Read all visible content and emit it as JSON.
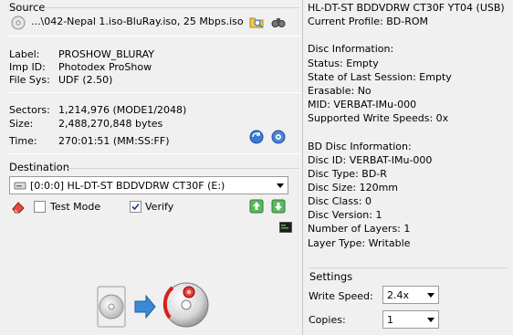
{
  "source": {
    "title": "Source",
    "file": "...\\042-Nepal 1.iso-BluRay.iso, 25 Mbps.iso",
    "label_key": "Label:",
    "label_value": "PROSHOW_BLURAY",
    "imp_key": "Imp ID:",
    "imp_value": "Photodex ProShow",
    "fs_key": "File Sys:",
    "fs_value": "UDF (2.50)",
    "sectors_key": "Sectors:",
    "sectors_value": "1,214,976 (MODE1/2048)",
    "size_key": "Size:",
    "size_value": "2,488,270,848 bytes",
    "time_key": "Time:",
    "time_value": "270:01:51 (MM:SS:FF)"
  },
  "destination": {
    "title": "Destination",
    "drive": "[0:0:0] HL-DT-ST BDDVDRW CT30F (E:)",
    "test_mode_label": "Test Mode",
    "test_mode_checked": false,
    "verify_label": "Verify",
    "verify_checked": true
  },
  "info": {
    "lines": [
      "HL-DT-ST BDDVDRW CT30F YT04 (USB)",
      "Current Profile: BD-ROM",
      "",
      "Disc Information:",
      "Status: Empty",
      "State of Last Session: Empty",
      "Erasable: No",
      "MID: VERBAT-IMu-000",
      "Supported Write Speeds: 0x",
      "",
      "BD Disc Information:",
      "Disc ID: VERBAT-IMu-000",
      "Disc Type: BD-R",
      "Disc Size: 120mm",
      "Disc Class: 0",
      "Disc Version: 1",
      "Number of Layers: 1",
      "Layer Type: Writable"
    ]
  },
  "settings": {
    "title": "Settings",
    "write_speed_label": "Write Speed:",
    "write_speed_value": "2.4x",
    "copies_label": "Copies:",
    "copies_value": "1"
  }
}
